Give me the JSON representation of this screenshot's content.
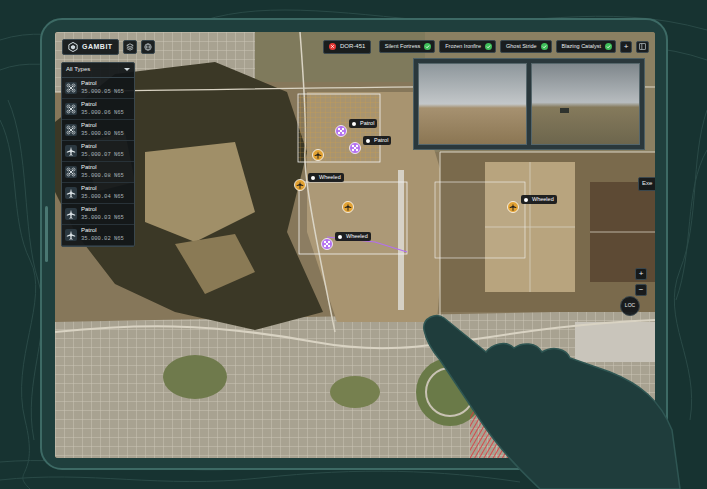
{
  "app": {
    "logo": "GAMBIT"
  },
  "alert": {
    "label": "DOR-451"
  },
  "missions": [
    {
      "label": "Silent Fortress",
      "checked": true
    },
    {
      "label": "Frozen Ironfire",
      "checked": true
    },
    {
      "label": "Ghost Stride",
      "checked": true
    },
    {
      "label": "Blazing Catalyst",
      "checked": true
    }
  ],
  "mission_add": "+",
  "filter": {
    "label": "All Types"
  },
  "assets": [
    {
      "label": "Patrol",
      "coords": "35.000.05 N65",
      "kind": "quad"
    },
    {
      "label": "Patrol",
      "coords": "35.000.06 N65",
      "kind": "quad"
    },
    {
      "label": "Patrol",
      "coords": "35.000.00 N65",
      "kind": "quad"
    },
    {
      "label": "Patrol",
      "coords": "35.000.07 N65",
      "kind": "plane"
    },
    {
      "label": "Patrol",
      "coords": "35.000.08 N65",
      "kind": "quad"
    },
    {
      "label": "Patrol",
      "coords": "35.000.04 N65",
      "kind": "plane"
    },
    {
      "label": "Patrol",
      "coords": "35.000.03 N65",
      "kind": "plane"
    },
    {
      "label": "Patrol",
      "coords": "35.000.02 N65",
      "kind": "plane"
    }
  ],
  "markers": [
    {
      "label": "Patrol",
      "color": "#b36ff0",
      "kind": "drone"
    },
    {
      "label": "Patrol",
      "color": "#b36ff0",
      "kind": "drone"
    },
    {
      "color": "#e2a233",
      "kind": "aircraft"
    },
    {
      "label": "Wheeled",
      "color": "#e2a233",
      "kind": "aircraft"
    },
    {
      "color": "#e2a233",
      "kind": "aircraft"
    },
    {
      "label": "Wheeled",
      "color": "#b36ff0",
      "kind": "drone"
    },
    {
      "label": "Wheeled",
      "color": "#e2a233",
      "kind": "aircraft"
    }
  ],
  "side_tab": "Exe",
  "zoom": [
    "+",
    "−"
  ],
  "locate": "LOC"
}
